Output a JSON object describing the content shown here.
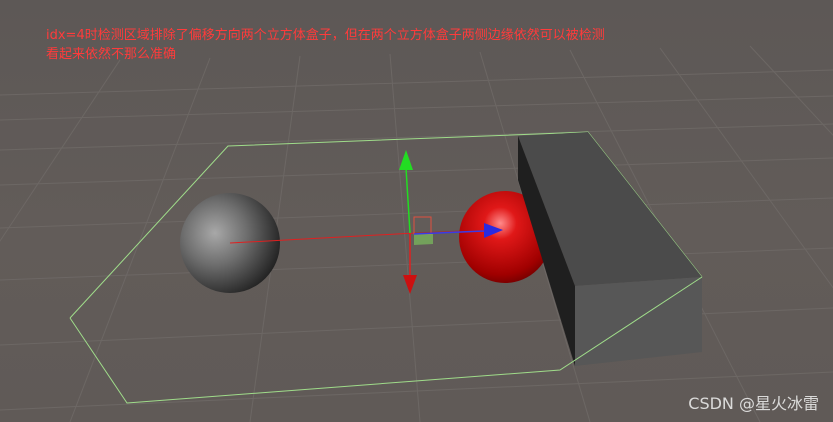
{
  "annotation": {
    "line1": "idx=4时检测区域排除了偏移方向两个立方体盒子，但在两个立方体盒子两侧边缘依然可以被检测",
    "line2": "看起来依然不那么准确"
  },
  "watermark": "CSDN @星火冰雷",
  "scene": {
    "background_color": "#5f5a57",
    "grid_color": "#6e6966",
    "detection_box_color": "#9fdc8a",
    "gray_sphere_color": "#8a8a8a",
    "red_sphere_color": "#d01010",
    "cube_color": "#4a4a4a",
    "axis_x_color": "#e02020",
    "axis_y_color": "#22dd22",
    "axis_z_color": "#2a2ae0"
  }
}
